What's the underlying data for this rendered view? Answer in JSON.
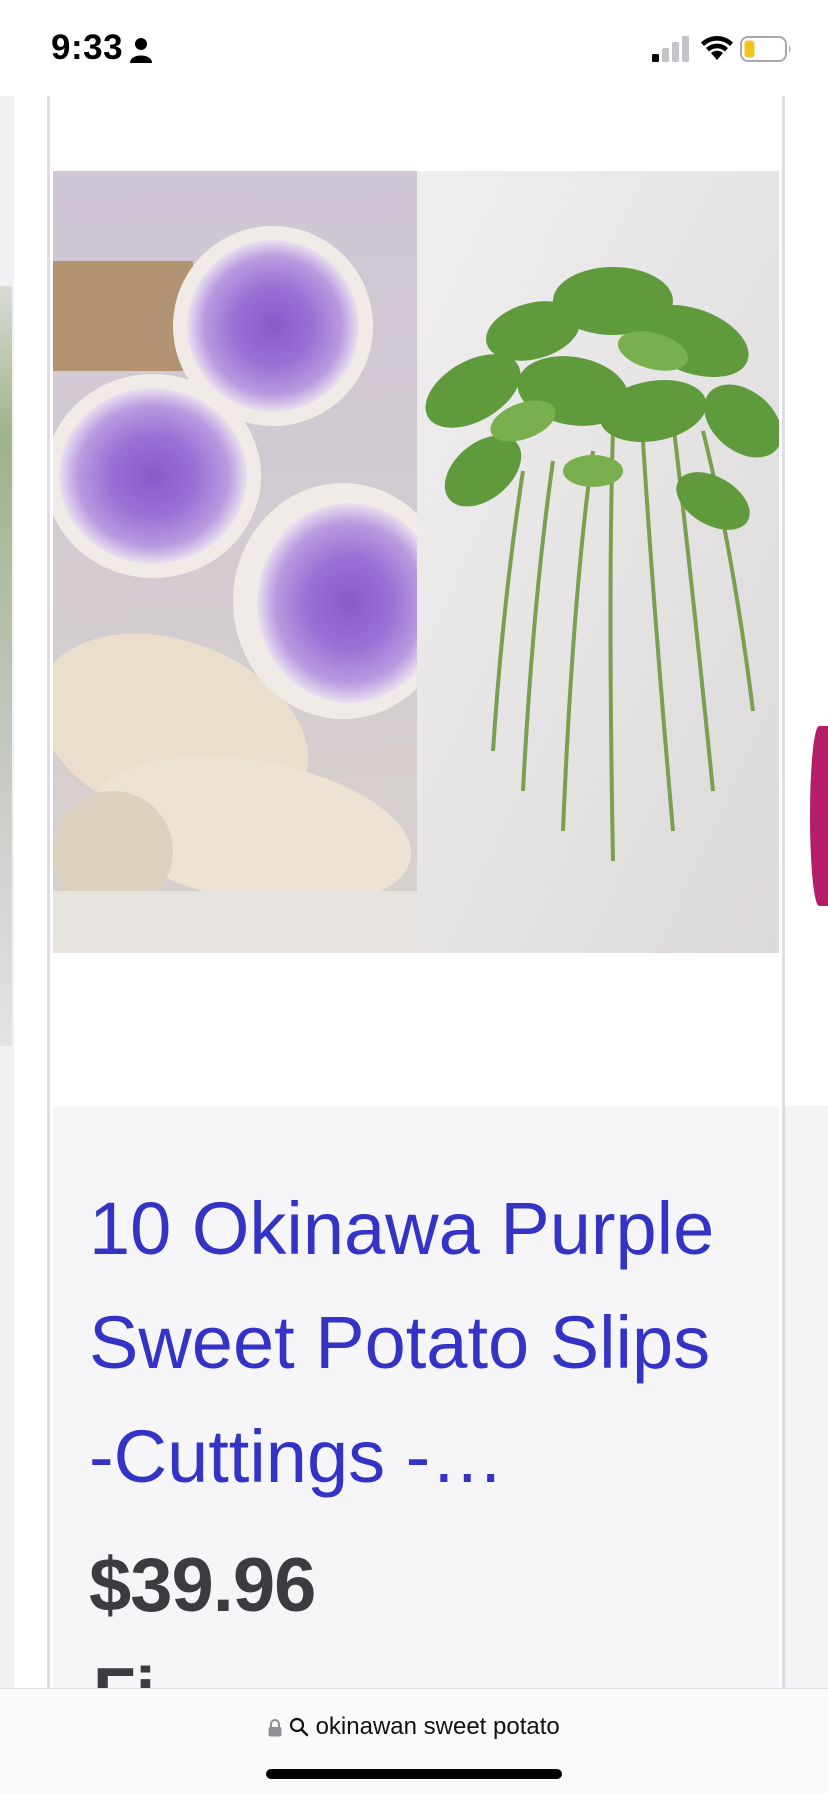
{
  "status_bar": {
    "time": "9:33"
  },
  "product": {
    "title": "10 Okinawa Purple Sweet Potato Slips -Cuttings -…",
    "price": "$39.96",
    "next_line_fragment": "Fi"
  },
  "url_bar": {
    "query": "okinawan sweet potato"
  },
  "colors": {
    "title_link": "#3333c5",
    "price_text": "#3c3c40",
    "card_info_bg": "#f6f6f8",
    "card_border": "#dddde3"
  }
}
